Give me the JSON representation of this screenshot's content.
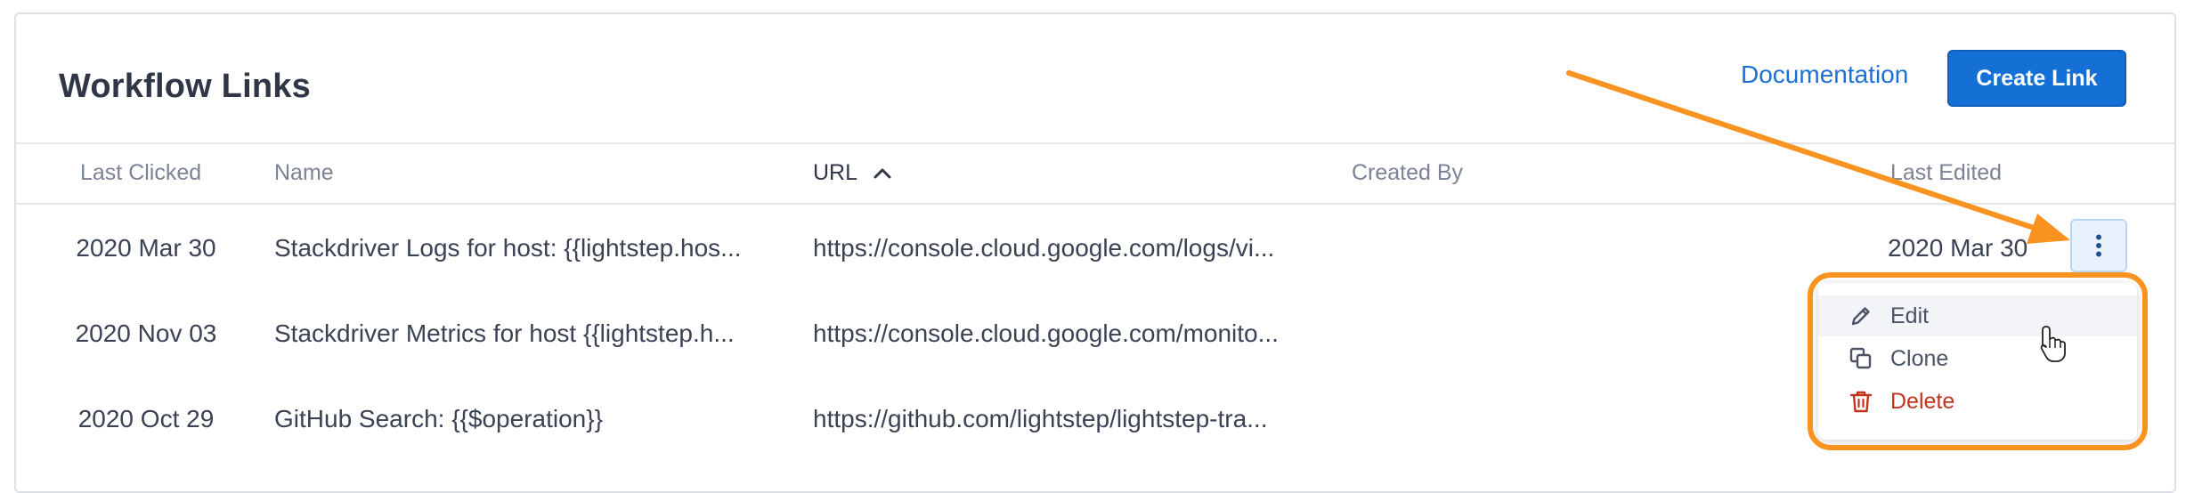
{
  "header": {
    "title": "Workflow Links",
    "documentation_label": "Documentation",
    "create_label": "Create Link"
  },
  "table": {
    "columns": [
      "Last Clicked",
      "Name",
      "URL",
      "Created By",
      "Last Edited"
    ],
    "sorted_column": "URL",
    "sort_direction": "ascending",
    "rows": [
      {
        "last_clicked": "2020 Mar 30",
        "name": "Stackdriver Logs for host: {{lightstep.hos...",
        "url": "https://console.cloud.google.com/logs/vi...",
        "created_by": "",
        "last_edited": "2020 Mar 30"
      },
      {
        "last_clicked": "2020 Nov 03",
        "name": "Stackdriver Metrics for host {{lightstep.h...",
        "url": "https://console.cloud.google.com/monito...",
        "created_by": "",
        "last_edited": ""
      },
      {
        "last_clicked": "2020 Oct 29",
        "name": "GitHub Search: {{$operation}}",
        "url": "https://github.com/lightstep/lightstep-tra...",
        "created_by": "",
        "last_edited": ""
      }
    ]
  },
  "row_menu": {
    "items": [
      {
        "label": "Edit",
        "icon": "pencil-icon"
      },
      {
        "label": "Clone",
        "icon": "copy-icon"
      },
      {
        "label": "Delete",
        "icon": "trash-icon"
      }
    ]
  },
  "colors": {
    "accent": "#1570d6",
    "link": "#1d6fd1",
    "danger": "#c0331f",
    "annotation": "#f7931e"
  }
}
